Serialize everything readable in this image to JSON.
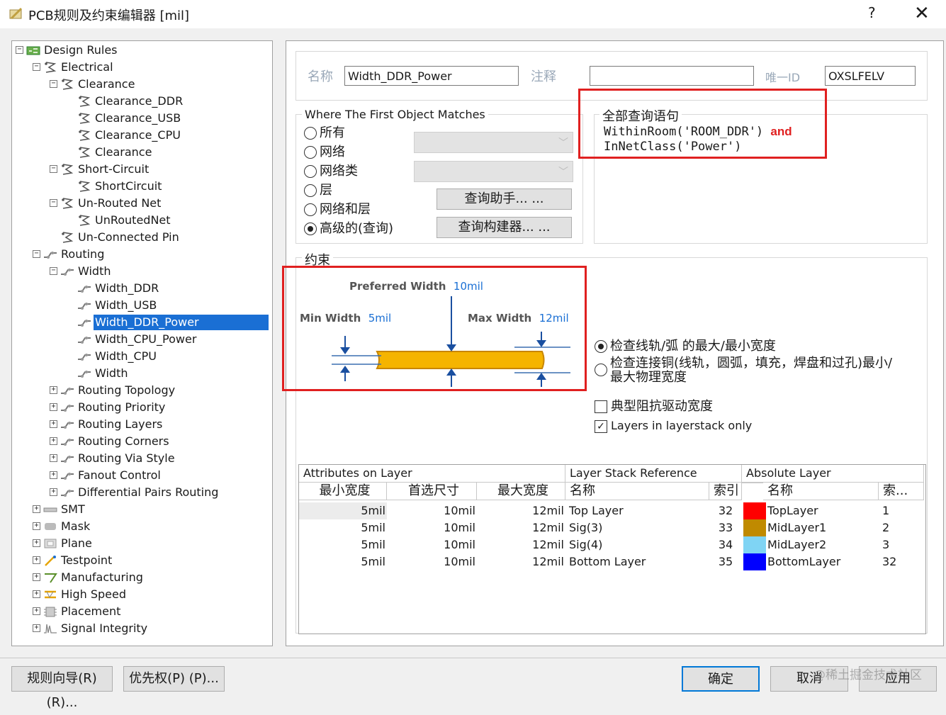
{
  "window": {
    "title": "PCB规则及约束编辑器 [mil]",
    "help": "?",
    "close": "✕"
  },
  "tree": [
    {
      "label": "Design Rules",
      "expander": "-"
    },
    {
      "label": "Electrical",
      "expander": "-"
    },
    {
      "label": "Clearance",
      "expander": "-"
    },
    {
      "label": "Clearance_DDR",
      "expander": ""
    },
    {
      "label": "Clearance_USB",
      "expander": ""
    },
    {
      "label": "Clearance_CPU",
      "expander": ""
    },
    {
      "label": "Clearance",
      "expander": ""
    },
    {
      "label": "Short-Circuit",
      "expander": "-"
    },
    {
      "label": "ShortCircuit",
      "expander": ""
    },
    {
      "label": "Un-Routed Net",
      "expander": "-"
    },
    {
      "label": "UnRoutedNet",
      "expander": ""
    },
    {
      "label": "Un-Connected Pin",
      "expander": ""
    },
    {
      "label": "Routing",
      "expander": "-"
    },
    {
      "label": "Width",
      "expander": "-"
    },
    {
      "label": "Width_DDR",
      "expander": ""
    },
    {
      "label": "Width_USB",
      "expander": ""
    },
    {
      "label": "Width_DDR_Power",
      "expander": ""
    },
    {
      "label": "Width_CPU_Power",
      "expander": ""
    },
    {
      "label": "Width_CPU",
      "expander": ""
    },
    {
      "label": "Width",
      "expander": ""
    },
    {
      "label": "Routing Topology",
      "expander": "+"
    },
    {
      "label": "Routing Priority",
      "expander": "+"
    },
    {
      "label": "Routing Layers",
      "expander": "+"
    },
    {
      "label": "Routing Corners",
      "expander": "+"
    },
    {
      "label": "Routing Via Style",
      "expander": "+"
    },
    {
      "label": "Fanout Control",
      "expander": "+"
    },
    {
      "label": "Differential Pairs Routing",
      "expander": "+"
    },
    {
      "label": "SMT",
      "expander": "+"
    },
    {
      "label": "Mask",
      "expander": "+"
    },
    {
      "label": "Plane",
      "expander": "+"
    },
    {
      "label": "Testpoint",
      "expander": "+"
    },
    {
      "label": "Manufacturing",
      "expander": "+"
    },
    {
      "label": "High Speed",
      "expander": "+"
    },
    {
      "label": "Placement",
      "expander": "+"
    },
    {
      "label": "Signal Integrity",
      "expander": "+"
    }
  ],
  "rule": {
    "name_label": "名称",
    "name_value": "Width_DDR_Power",
    "comment_label": "注释",
    "comment_value": "",
    "uid_label": "唯一ID",
    "uid_value": "OXSLFELV"
  },
  "match": {
    "title": "Where The First Object Matches",
    "options": [
      "所有",
      "网络",
      "网络类",
      "层",
      "网络和层",
      "高级的(查询)"
    ],
    "selected": "高级的(查询)",
    "helper_button": "查询助手... ...",
    "builder_button": "查询构建器... ..."
  },
  "query": {
    "title": "全部查询语句",
    "line1_a": "WithinRoom('ROOM_DDR')",
    "line1_and": "and",
    "line2": "InNetClass('Power')"
  },
  "constraints": {
    "title": "约束",
    "preferred_label": "Preferred Width",
    "preferred_value": "10mil",
    "min_label": "Min Width",
    "min_value": "5mil",
    "max_label": "Max Width",
    "max_value": "12mil",
    "radio1": "检查线轨/弧 的最大/最小宽度",
    "radio2": "检查连接铜(线轨，圆弧，填充，焊盘和过孔)最小/最大物理宽度",
    "check1": "典型阻抗驱动宽度",
    "check2": "Layers in layerstack only"
  },
  "table": {
    "group_headers": [
      "Attributes on Layer",
      "Layer Stack Reference",
      "Absolute Layer"
    ],
    "columns": [
      "最小宽度",
      "首选尺寸",
      "最大宽度",
      "名称",
      "索引",
      "名称",
      "索..."
    ],
    "rows": [
      {
        "min": "5mil",
        "pref": "10mil",
        "max": "12mil",
        "name": "Top Layer",
        "index": "32",
        "color": "#ff0000",
        "abs_name": "TopLayer",
        "abs_index": "1"
      },
      {
        "min": "5mil",
        "pref": "10mil",
        "max": "12mil",
        "name": "Sig(3)",
        "index": "33",
        "color": "#c08a00",
        "abs_name": "MidLayer1",
        "abs_index": "2"
      },
      {
        "min": "5mil",
        "pref": "10mil",
        "max": "12mil",
        "name": "Sig(4)",
        "index": "34",
        "color": "#7fd4f4",
        "abs_name": "MidLayer2",
        "abs_index": "3"
      },
      {
        "min": "5mil",
        "pref": "10mil",
        "max": "12mil",
        "name": "Bottom Layer",
        "index": "35",
        "color": "#0000ff",
        "abs_name": "BottomLayer",
        "abs_index": "32"
      }
    ]
  },
  "bottom": {
    "wizard": "规则向导(R) (R)...",
    "priority": "优先权(P) (P)...",
    "ok": "确定",
    "cancel": "取消",
    "apply": "应用",
    "watermark": "@稀土掘金技术社区"
  }
}
